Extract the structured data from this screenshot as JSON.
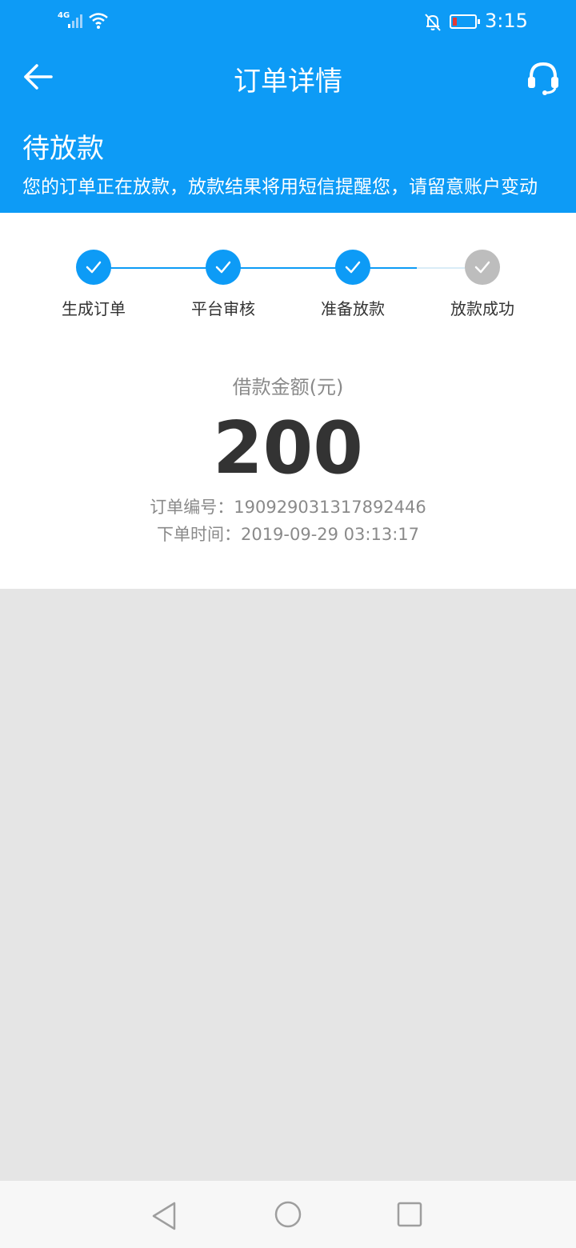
{
  "status_bar": {
    "network": "4G",
    "time": "3:15",
    "colors": {
      "battery_low": "#e53935"
    }
  },
  "header": {
    "title": "订单详情",
    "back_icon": "arrow-left-icon",
    "support_icon": "headset-icon"
  },
  "order_status": {
    "title": "待放款",
    "description": "您的订单正在放款，放款结果将用短信提醒您，请留意账户变动"
  },
  "progress": {
    "steps": [
      {
        "label": "生成订单",
        "done": true
      },
      {
        "label": "平台审核",
        "done": true
      },
      {
        "label": "准备放款",
        "done": true
      },
      {
        "label": "放款成功",
        "done": false
      }
    ],
    "colors": {
      "done": "#0d9bf6",
      "pending": "#bdbdbd",
      "line_pending": "#d9ecf7"
    }
  },
  "loan": {
    "amount_label": "借款金额(元)",
    "amount": "200",
    "order_no_line": "订单编号：190929031317892446",
    "order_time_line": "下单时间：2019-09-29 03:13:17"
  },
  "nav": {
    "back": "triangle-back-icon",
    "home": "circle-home-icon",
    "recents": "square-recents-icon"
  },
  "theme": {
    "brand": "#0d9bf6",
    "background": "#e5e5e5"
  }
}
